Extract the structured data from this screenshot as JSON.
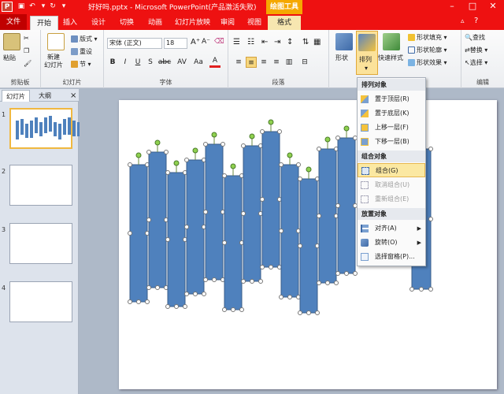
{
  "title_bar": {
    "title": "好好吗.pptx - Microsoft PowerPoint(产品激活失败)",
    "context_tab": "绘图工具",
    "app_icon": "P",
    "controls": [
      "minimize",
      "maximize",
      "close"
    ]
  },
  "tabs": [
    {
      "label": "文件",
      "kind": "file"
    },
    {
      "label": "开始",
      "kind": "active"
    },
    {
      "label": "插入"
    },
    {
      "label": "设计"
    },
    {
      "label": "切换"
    },
    {
      "label": "动画"
    },
    {
      "label": "幻灯片放映"
    },
    {
      "label": "审阅"
    },
    {
      "label": "视图"
    },
    {
      "label": "格式",
      "kind": "format"
    }
  ],
  "ribbon": {
    "clipboard": {
      "label": "剪贴板",
      "paste": "粘贴"
    },
    "slides": {
      "label": "幻灯片",
      "new_slide": "新建\n幻灯片",
      "layout": "版式",
      "reset": "重设",
      "section": "节"
    },
    "font": {
      "label": "字体",
      "font_name": "宋体 (正文)",
      "font_size": "18",
      "buttons": [
        "B",
        "I",
        "U",
        "S",
        "abc",
        "AV",
        "Aa",
        "A"
      ]
    },
    "paragraph": {
      "label": "段落"
    },
    "drawing": {
      "shapes": "形状",
      "arrange": "排列",
      "quick_styles": "快速样式",
      "shape_fill": "形状填充",
      "shape_outline": "形状轮廓",
      "shape_effects": "形状效果"
    },
    "editing": {
      "label": "编辑",
      "find": "查找",
      "replace": "替换",
      "select": "选择"
    }
  },
  "side_panel": {
    "tabs": [
      "幻灯片",
      "大纲"
    ],
    "close": "×",
    "slides": [
      "1",
      "2",
      "3",
      "4"
    ]
  },
  "arrange_menu": {
    "sections": [
      {
        "header": "排列对象",
        "items": [
          {
            "label": "置于顶层(R)",
            "icon": "bring-front-icon"
          },
          {
            "label": "置于底层(K)",
            "icon": "send-back-icon"
          },
          {
            "label": "上移一层(F)",
            "icon": "bring-forward-icon"
          },
          {
            "label": "下移一层(B)",
            "icon": "send-backward-icon"
          }
        ]
      },
      {
        "header": "组合对象",
        "items": [
          {
            "label": "组合(G)",
            "icon": "group-icon",
            "highlighted": true
          },
          {
            "label": "取消组合(U)",
            "icon": "ungroup-icon",
            "disabled": true
          },
          {
            "label": "重新组合(E)",
            "icon": "regroup-icon",
            "disabled": true
          }
        ]
      },
      {
        "header": "放置对象",
        "items": [
          {
            "label": "对齐(A)",
            "icon": "align-icon",
            "submenu": true
          },
          {
            "label": "旋转(O)",
            "icon": "rotate-icon",
            "submenu": true
          },
          {
            "label": "选择窗格(P)...",
            "icon": "selection-pane-icon"
          }
        ]
      }
    ]
  },
  "colors": {
    "title_red": "#ee1111",
    "shape_blue": "#4f81bd",
    "shape_blue_dark": "#385d8a",
    "highlight": "#fbe8a2",
    "context_orange": "#f5a800"
  }
}
